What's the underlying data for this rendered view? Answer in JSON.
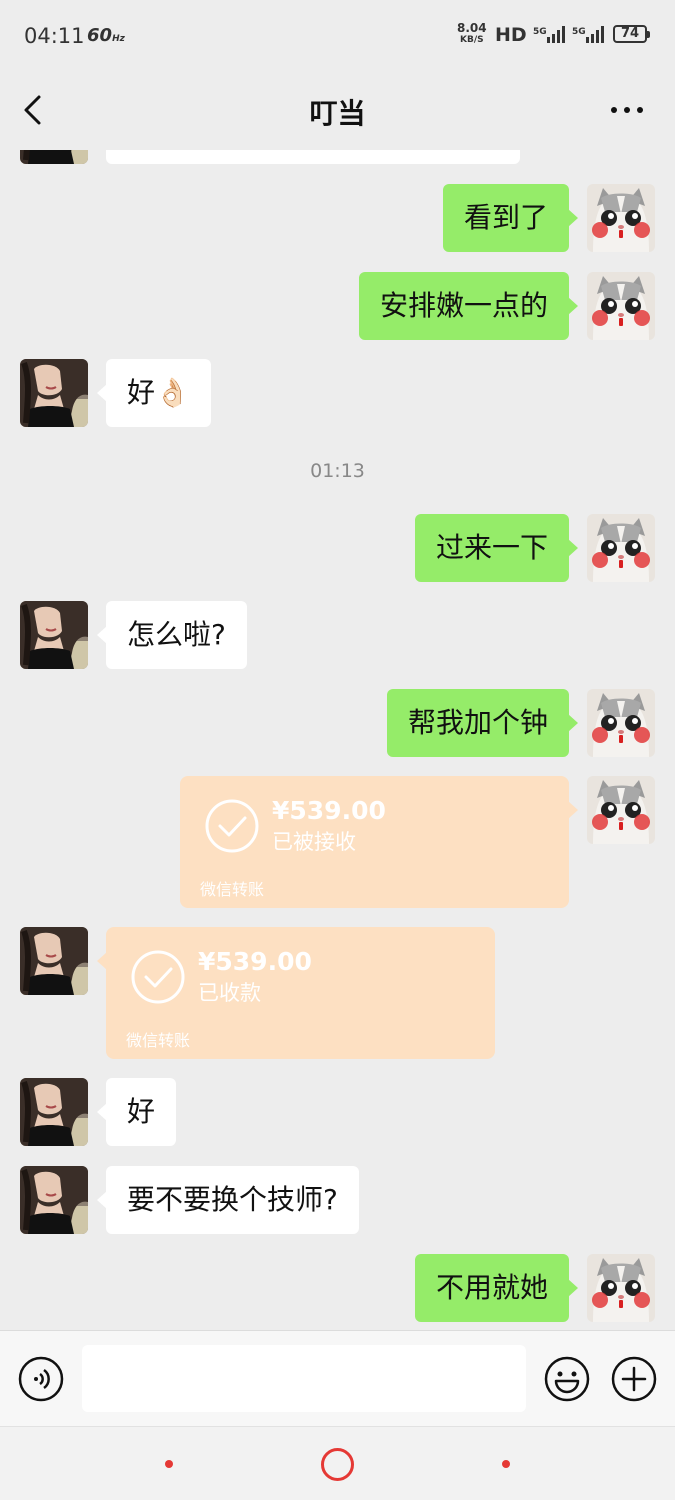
{
  "status_bar": {
    "time": "04:11",
    "refresh_rate": "60",
    "refresh_unit": "Hz",
    "net_speed": "8.04",
    "net_unit": "KB/S",
    "hd": "HD",
    "signal1": "5G",
    "signal2": "5G",
    "battery": "74"
  },
  "header": {
    "title": "叮当"
  },
  "messages": {
    "m1": "看到了",
    "m2": "安排嫩一点的",
    "m3": "好👌🏻",
    "time1": "01:13",
    "m4": "过来一下",
    "m5": "怎么啦?",
    "m6": "帮我加个钟",
    "m7": "好",
    "m8": "要不要换个技师?",
    "m9": "不用就她"
  },
  "transfers": {
    "sent": {
      "amount": "¥539.00",
      "status": "已被接收",
      "label": "微信转账"
    },
    "received": {
      "amount": "¥539.00",
      "status": "已收款",
      "label": "微信转账"
    }
  },
  "input": {
    "placeholder": ""
  },
  "colors": {
    "out_bubble": "#95ec69",
    "in_bubble": "#ffffff",
    "transfer": "#fde0c2",
    "nav_accent": "#e53935"
  }
}
